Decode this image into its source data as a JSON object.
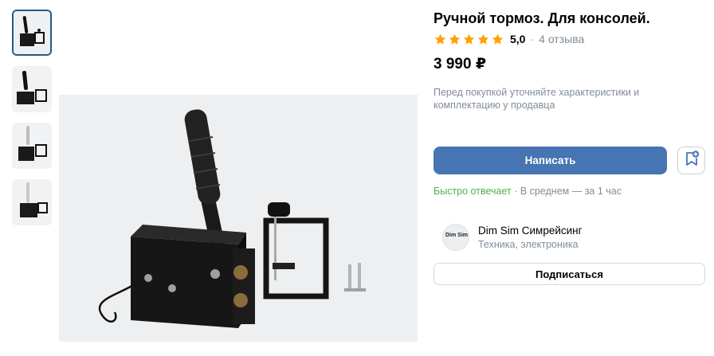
{
  "product": {
    "title": "Ручной тормоз. Для консолей.",
    "rating": "5,0",
    "stars_filled": 5,
    "stars_total": 5,
    "reviews": "4 отзыва",
    "separator": "·",
    "price": "3 990 ₽",
    "note": "Перед покупкой уточняйте характеристики и комплектацию у продавца"
  },
  "actions": {
    "write_label": "Написать",
    "bookmark_icon": "bookmark-add-icon",
    "subscribe_label": "Подписаться"
  },
  "response": {
    "fast": "Быстро отвечает",
    "rest": " · В среднем — за 1 час"
  },
  "seller": {
    "avatar_text": "Dim Sim",
    "name": "Dim Sim Симрейсинг",
    "category": "Техника, электроника"
  },
  "colors": {
    "accent": "#4774b3",
    "star": "#ffa000",
    "green": "#4bb34b",
    "secondary": "#818c99"
  },
  "gallery": {
    "thumbnail_count": 4,
    "active_index": 0
  }
}
